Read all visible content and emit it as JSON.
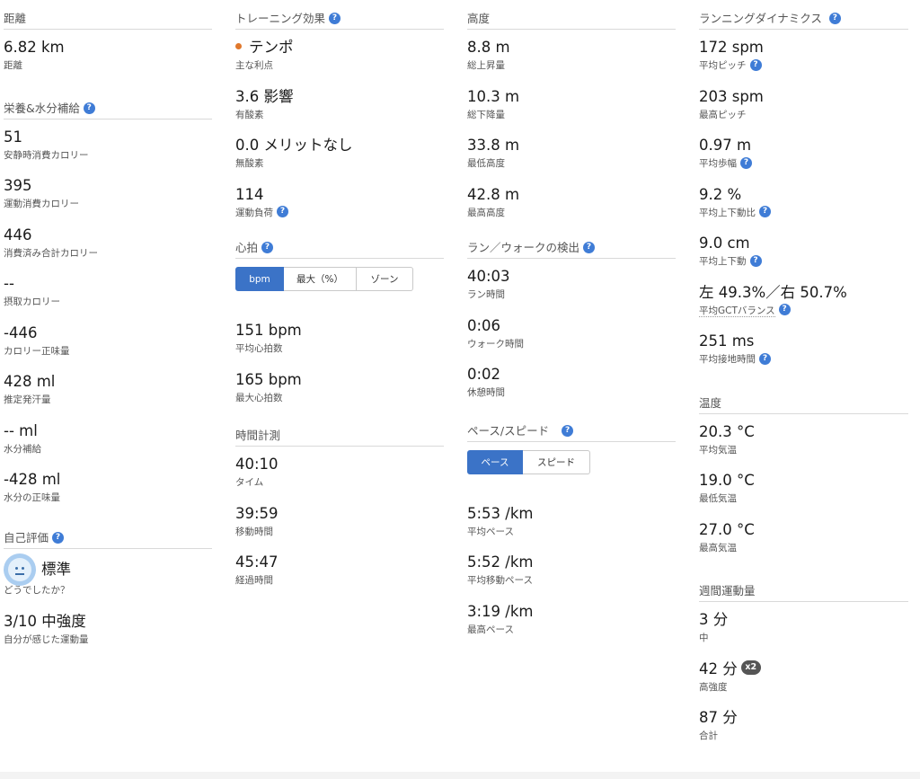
{
  "col1": {
    "distance": {
      "header": "距離",
      "items": [
        {
          "value": "6.82 km",
          "label": "距離"
        }
      ]
    },
    "nutrition": {
      "header": "栄養&水分補給",
      "items": [
        {
          "value": "51",
          "label": "安静時消費カロリー"
        },
        {
          "value": "395",
          "label": "運動消費カロリー"
        },
        {
          "value": "446",
          "label": "消費済み合計カロリー"
        },
        {
          "value": "--",
          "label": "摂取カロリー"
        },
        {
          "value": "-446",
          "label": "カロリー正味量"
        },
        {
          "value": "428 ml",
          "label": "推定発汗量"
        },
        {
          "value": "-- ml",
          "label": "水分補給"
        },
        {
          "value": "-428 ml",
          "label": "水分の正味量"
        }
      ]
    },
    "self_eval": {
      "header": "自己評価",
      "feeling": {
        "value": "標準",
        "label": "どうでしたか？"
      },
      "effort": {
        "value": "3/10 中強度",
        "label": "自分が感じた運動量"
      }
    }
  },
  "col2": {
    "training": {
      "header": "トレーニング効果",
      "primary": {
        "value": "テンポ",
        "label": "主な利点"
      },
      "items": [
        {
          "value": "3.6 影響",
          "label": "有酸素"
        },
        {
          "value": "0.0 メリットなし",
          "label": "無酸素"
        }
      ],
      "load": {
        "value": "114",
        "label": "運動負荷"
      }
    },
    "heart_rate": {
      "header": "心拍",
      "tabs": [
        "bpm",
        "最大（%）",
        "ゾーン"
      ],
      "items": [
        {
          "value": "151 bpm",
          "label": "平均心拍数"
        },
        {
          "value": "165 bpm",
          "label": "最大心拍数"
        }
      ]
    },
    "timing": {
      "header": "時間計測",
      "items": [
        {
          "value": "40:10",
          "label": "タイム"
        },
        {
          "value": "39:59",
          "label": "移動時間"
        },
        {
          "value": "45:47",
          "label": "経過時間"
        }
      ]
    }
  },
  "col3": {
    "elevation": {
      "header": "高度",
      "items": [
        {
          "value": "8.8 m",
          "label": "総上昇量"
        },
        {
          "value": "10.3 m",
          "label": "総下降量"
        },
        {
          "value": "33.8 m",
          "label": "最低高度"
        },
        {
          "value": "42.8 m",
          "label": "最高高度"
        }
      ]
    },
    "run_walk": {
      "header": "ラン／ウォークの検出",
      "items": [
        {
          "value": "40:03",
          "label": "ラン時間"
        },
        {
          "value": "0:06",
          "label": "ウォーク時間"
        },
        {
          "value": "0:02",
          "label": "休憩時間"
        }
      ]
    },
    "pace": {
      "header": "ペース/スピード",
      "tabs": [
        "ペース",
        "スピード"
      ],
      "items": [
        {
          "value": "5:53 /km",
          "label": "平均ペース"
        },
        {
          "value": "5:52 /km",
          "label": "平均移動ペース"
        },
        {
          "value": "3:19 /km",
          "label": "最高ペース"
        }
      ]
    }
  },
  "col4": {
    "dynamics": {
      "header": "ランニングダイナミクス",
      "items": [
        {
          "value": "172 spm",
          "label": "平均ピッチ",
          "help": true
        },
        {
          "value": "203 spm",
          "label": "最高ピッチ",
          "help": false
        },
        {
          "value": "0.97 m",
          "label": "平均歩幅",
          "help": true
        },
        {
          "value": "9.2 %",
          "label": "平均上下動比",
          "help": true
        },
        {
          "value": "9.0 cm",
          "label": "平均上下動",
          "help": true
        },
        {
          "value": "左 49.3%／右 50.7%",
          "label": "平均GCTバランス",
          "help": true
        },
        {
          "value": "251 ms",
          "label": "平均接地時間",
          "help": true
        }
      ]
    },
    "temperature": {
      "header": "温度",
      "items": [
        {
          "value": "20.3 °C",
          "label": "平均気温"
        },
        {
          "value": "19.0 °C",
          "label": "最低気温"
        },
        {
          "value": "27.0 °C",
          "label": "最高気温"
        }
      ]
    },
    "weekly": {
      "header": "週間運動量",
      "items": [
        {
          "value": "3 分",
          "label": "中"
        },
        {
          "value": "42 分",
          "label": "高強度",
          "badge": "x2"
        },
        {
          "value": "87 分",
          "label": "合計"
        }
      ]
    }
  },
  "help_glyph": "?"
}
